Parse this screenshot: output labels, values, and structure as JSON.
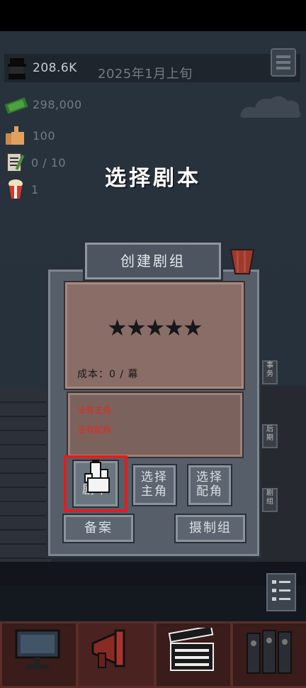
{
  "hud": {
    "followers": "208.6K",
    "date": "2025年1月上旬",
    "money": "298,000",
    "likes": "100",
    "scripts": "0 / 10",
    "popcorn": "1"
  },
  "title": "选择剧本",
  "panel": {
    "title": "创建剧组",
    "stars": "★★★★★",
    "cost": "成本：0 / 幕",
    "warn_lead": "没有主角",
    "warn_support": "没有配角"
  },
  "buttons": {
    "select_script": [
      "选",
      "剧本"
    ],
    "select_lead": [
      "选择",
      "主角"
    ],
    "select_support": [
      "选择",
      "配角"
    ],
    "file": "备案",
    "crew": "摄制组"
  },
  "side_tags": {
    "a": "事务",
    "b": "后期",
    "c": "剧组"
  },
  "colors": {
    "highlight": "#e01e1e",
    "warning": "#e02b1f",
    "card": "#8a6d66"
  }
}
